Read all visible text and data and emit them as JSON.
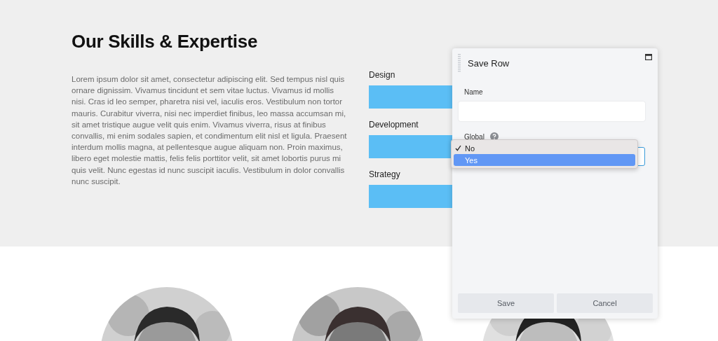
{
  "section": {
    "title": "Our Skills & Expertise",
    "body": "Lorem ipsum dolor sit amet, consectetur adipiscing elit. Sed tempus nisl quis ornare dignissim. Vivamus tincidunt et sem vitae luctus. Vivamus id mollis nisi. Cras id leo semper, pharetra nisi vel, iaculis eros. Vestibulum non tortor mauris. Curabitur viverra, nisi nec imperdiet finibus, leo massa accumsan mi, sit amet tristique augue velit quis enim. Vivamus viverra, risus at finibus convallis, mi enim sodales sapien, et condimentum elit nisl et ligula. Praesent interdum mollis magna, at pellentesque augue aliquam non. Proin maximus, libero eget molestie mattis, felis felis porttitor velit, sit amet lobortis purus mi quis velit. Nunc egestas id nunc suscipit iaculis. Vestibulum in dolor convallis nunc suscipit."
  },
  "skills": [
    {
      "name": "Design"
    },
    {
      "name": "Development"
    },
    {
      "name": "Strategy"
    }
  ],
  "dialog": {
    "title": "Save Row",
    "name_label": "Name",
    "global_label": "Global",
    "options": [
      {
        "label": "No",
        "checked": true,
        "selected": false
      },
      {
        "label": "Yes",
        "checked": false,
        "selected": true
      }
    ],
    "buttons": [
      "Save",
      "Cancel"
    ]
  }
}
